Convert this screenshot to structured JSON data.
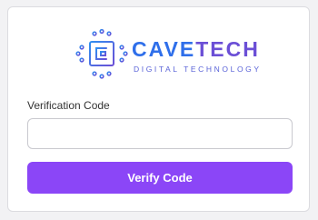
{
  "brand": {
    "name_part1": "CAVE",
    "name_part2": "TECH",
    "tagline": "DIGITAL TECHNOLOGY",
    "logo_icon": "circuit-chip-icon",
    "colors": {
      "blue": "#2f6fea",
      "purple": "#6b4fd6"
    }
  },
  "form": {
    "label": "Verification Code",
    "input_value": "",
    "input_placeholder": "",
    "submit_label": "Verify Code",
    "button_color": "#8b46f7"
  }
}
